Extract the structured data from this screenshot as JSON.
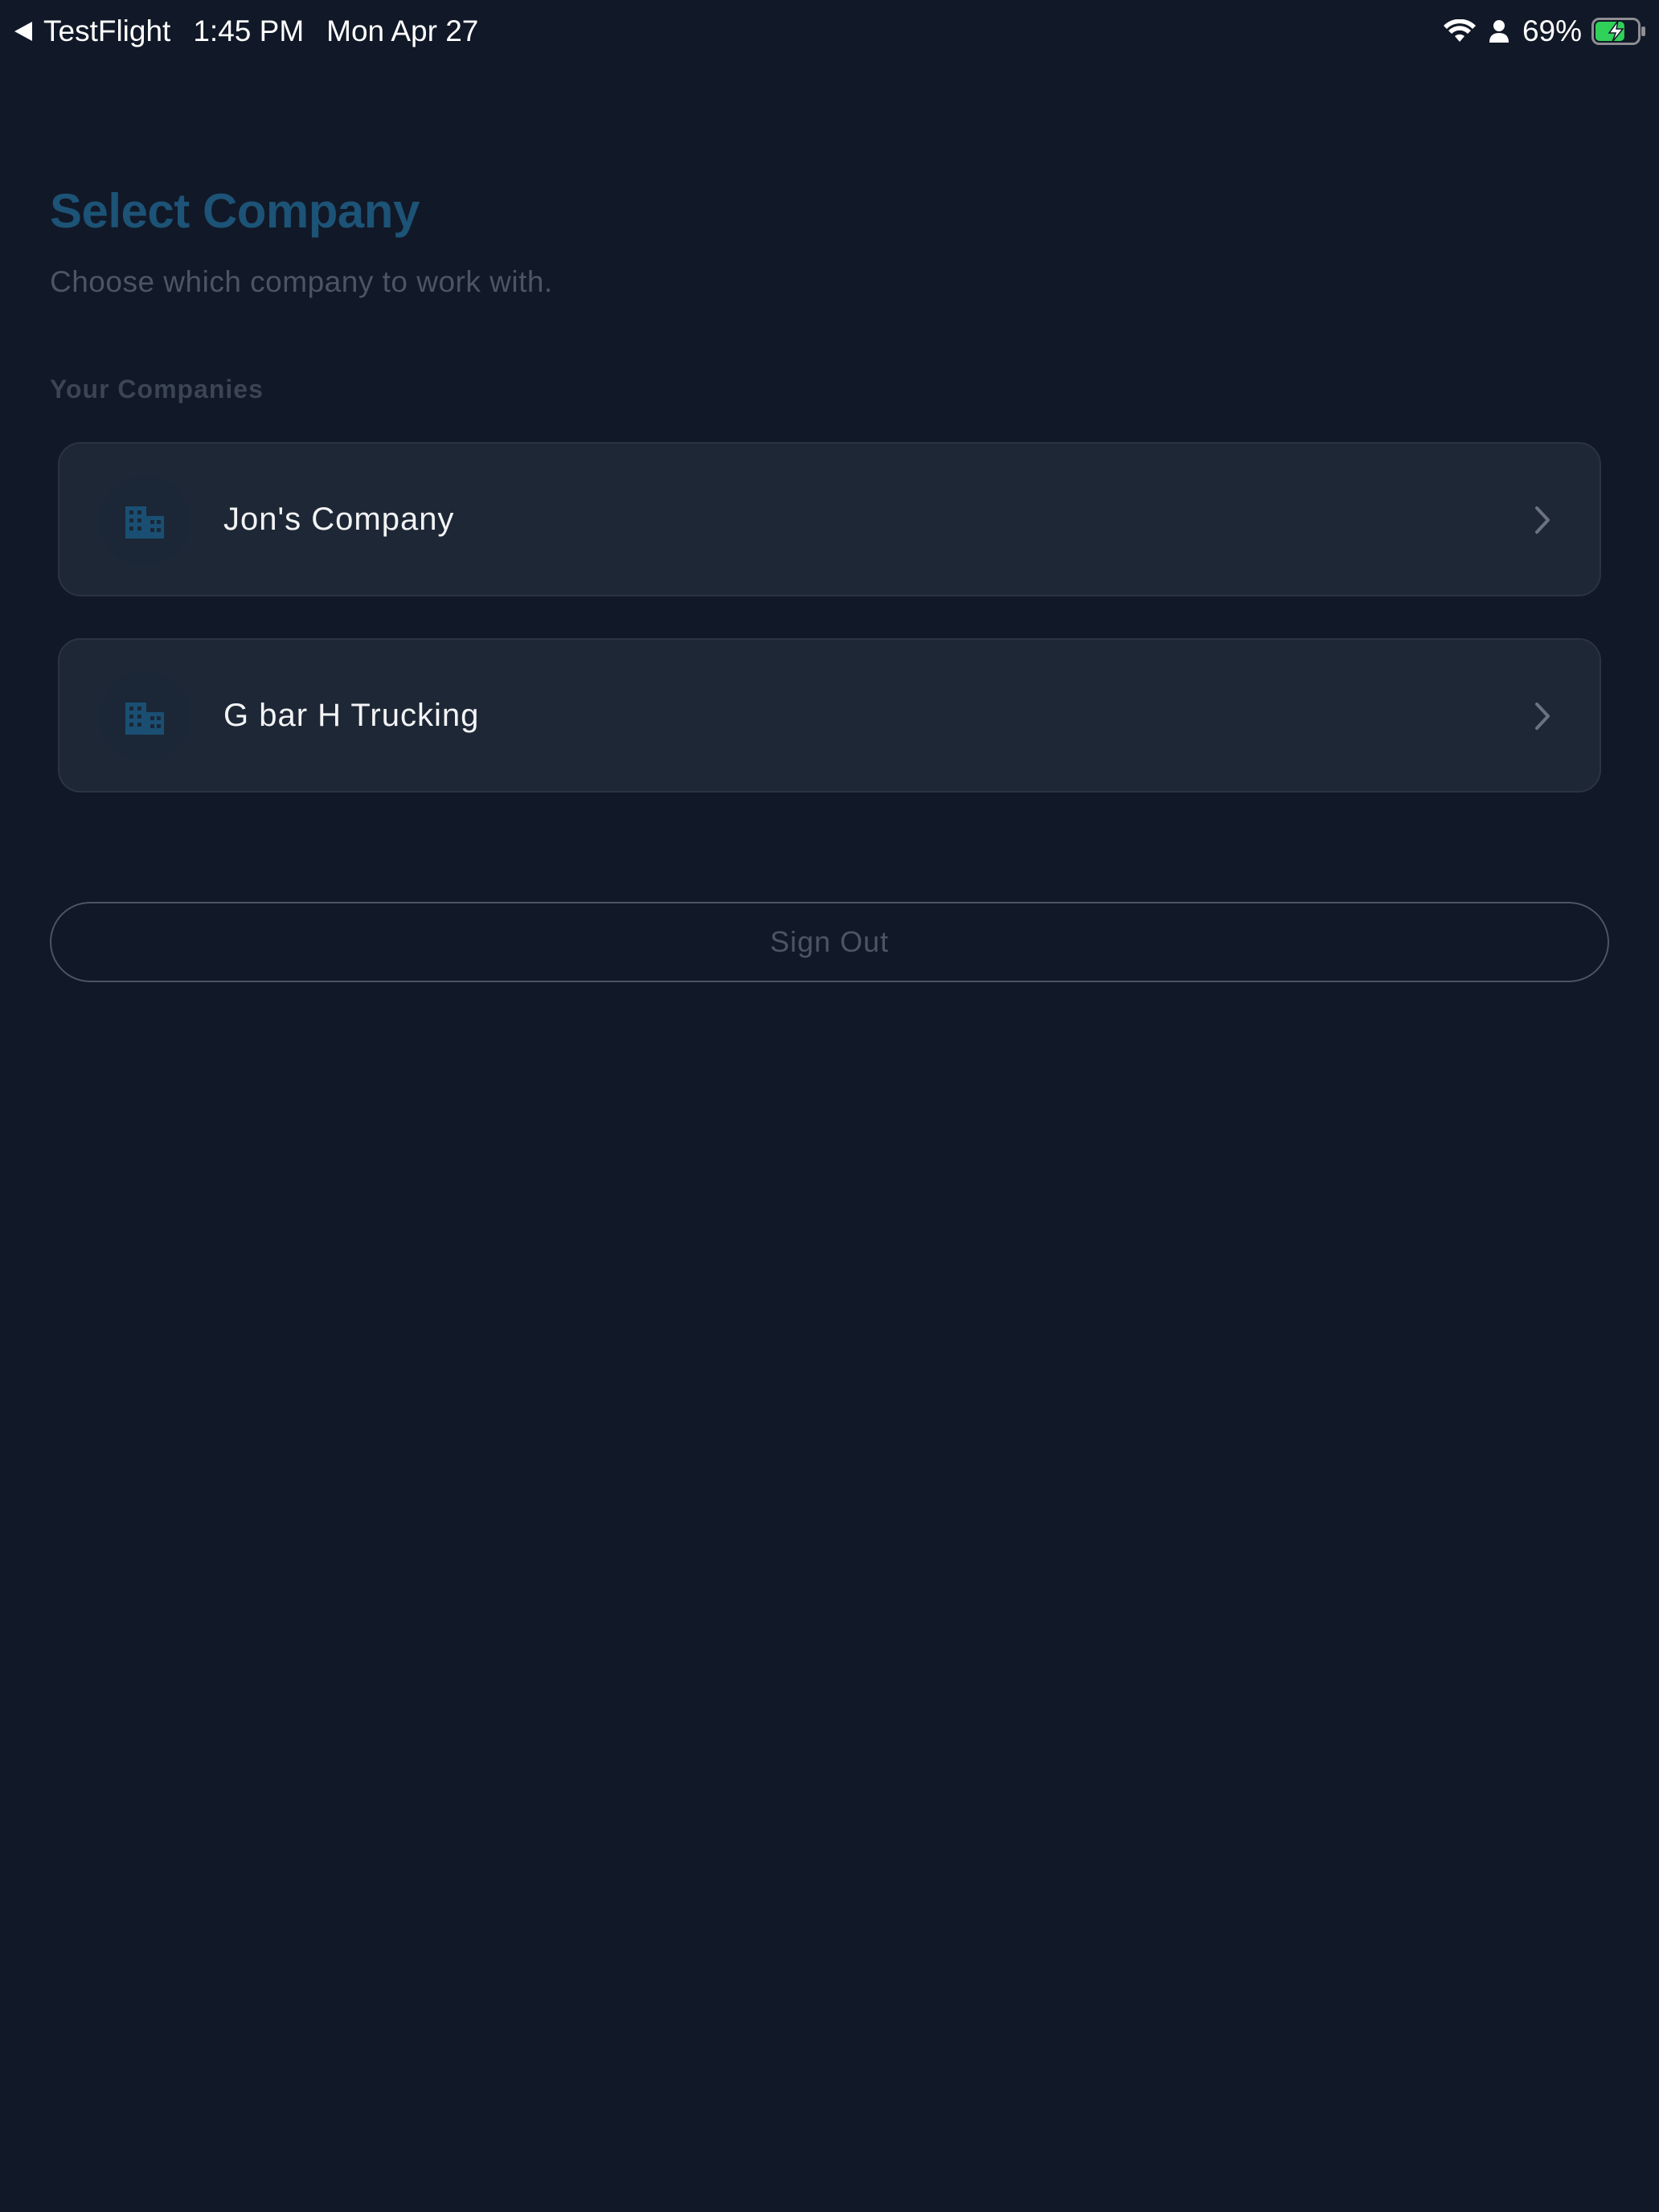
{
  "status_bar": {
    "back_app": "TestFlight",
    "time": "1:45 PM",
    "date": "Mon Apr 27",
    "battery_percent": "69%",
    "icons": [
      "back-arrow-icon",
      "wifi-icon",
      "person-icon",
      "battery-charging-icon"
    ],
    "battery_level": 0.69,
    "battery_color": "#30d158"
  },
  "header": {
    "title": "Select Company",
    "subtitle": "Choose which company to work with."
  },
  "companies": {
    "section_label": "Your Companies",
    "items": [
      {
        "name": "Jon's Company",
        "icon": "building-icon"
      },
      {
        "name": "G bar H Trucking",
        "icon": "building-icon"
      }
    ]
  },
  "actions": {
    "sign_out_label": "Sign Out"
  },
  "colors": {
    "background": "#111827",
    "title": "#1c5376",
    "card_background": "#1e2735",
    "muted_text": "#4b5563"
  }
}
